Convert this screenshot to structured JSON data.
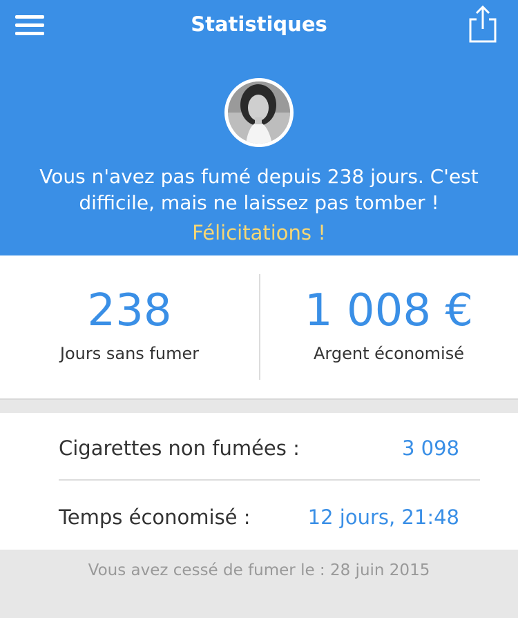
{
  "header": {
    "title": "Statistiques",
    "message": "Vous n'avez pas fumé depuis 238 jours. C'est difficile, mais ne laissez pas tomber !",
    "congrats": "Félicitations !"
  },
  "icons": {
    "menu": "hamburger-menu-icon",
    "share": "share-icon",
    "avatar": "user-avatar"
  },
  "summary": {
    "days_value": "238",
    "days_label": "Jours sans fumer",
    "money_value": "1 008 €",
    "money_label": "Argent économisé"
  },
  "details": [
    {
      "label": "Cigarettes non fumées :",
      "value": "3 098"
    },
    {
      "label": "Temps économisé :",
      "value": "12 jours, 21:48"
    }
  ],
  "footer": {
    "quit_date_text": "Vous avez cessé de fumer le : 28 juin 2015"
  },
  "colors": {
    "accent": "#3a8fe6",
    "highlight": "#f7d774",
    "background": "#e7e7e7"
  }
}
